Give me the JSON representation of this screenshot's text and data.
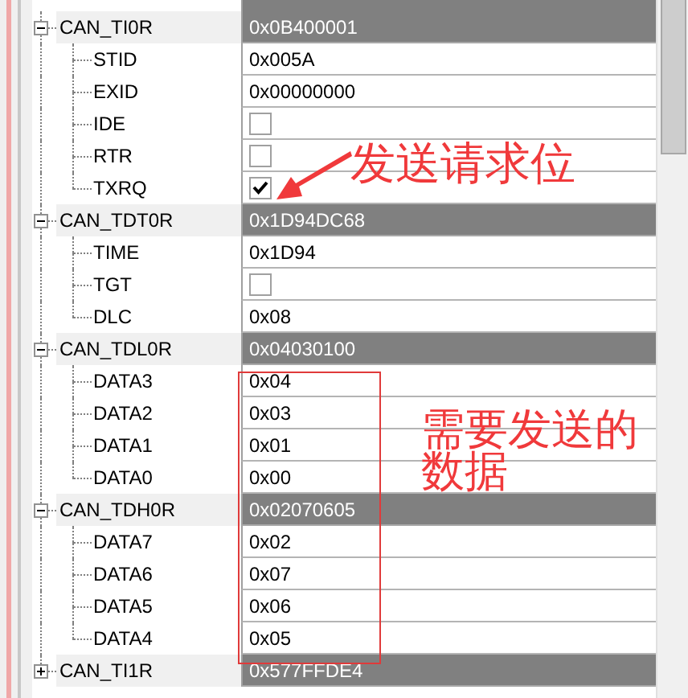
{
  "registers": [
    {
      "name": "CAN_TI0R",
      "value": "0x0B400001",
      "expanded": true,
      "fields": [
        {
          "name": "STID",
          "kind": "text",
          "value": "0x005A"
        },
        {
          "name": "EXID",
          "kind": "text",
          "value": "0x00000000"
        },
        {
          "name": "IDE",
          "kind": "checkbox",
          "checked": false
        },
        {
          "name": "RTR",
          "kind": "checkbox",
          "checked": false
        },
        {
          "name": "TXRQ",
          "kind": "checkbox",
          "checked": true
        }
      ]
    },
    {
      "name": "CAN_TDT0R",
      "value": "0x1D94DC68",
      "expanded": true,
      "fields": [
        {
          "name": "TIME",
          "kind": "text",
          "value": "0x1D94"
        },
        {
          "name": "TGT",
          "kind": "checkbox",
          "checked": false
        },
        {
          "name": "DLC",
          "kind": "text",
          "value": "0x08"
        }
      ]
    },
    {
      "name": "CAN_TDL0R",
      "value": "0x04030100",
      "expanded": true,
      "fields": [
        {
          "name": "DATA3",
          "kind": "text",
          "value": "0x04"
        },
        {
          "name": "DATA2",
          "kind": "text",
          "value": "0x03"
        },
        {
          "name": "DATA1",
          "kind": "text",
          "value": "0x01"
        },
        {
          "name": "DATA0",
          "kind": "text",
          "value": "0x00"
        }
      ]
    },
    {
      "name": "CAN_TDH0R",
      "value": "0x02070605",
      "expanded": true,
      "fields": [
        {
          "name": "DATA7",
          "kind": "text",
          "value": "0x02"
        },
        {
          "name": "DATA6",
          "kind": "text",
          "value": "0x07"
        },
        {
          "name": "DATA5",
          "kind": "text",
          "value": "0x06"
        },
        {
          "name": "DATA4",
          "kind": "text",
          "value": "0x05"
        }
      ]
    },
    {
      "name": "CAN_TI1R",
      "value": "0x577FFDE4",
      "expanded": false
    }
  ],
  "annotations": {
    "request_bit_note": "发送请求位",
    "data_note_lines": [
      "需要发送的",
      "数据"
    ]
  }
}
